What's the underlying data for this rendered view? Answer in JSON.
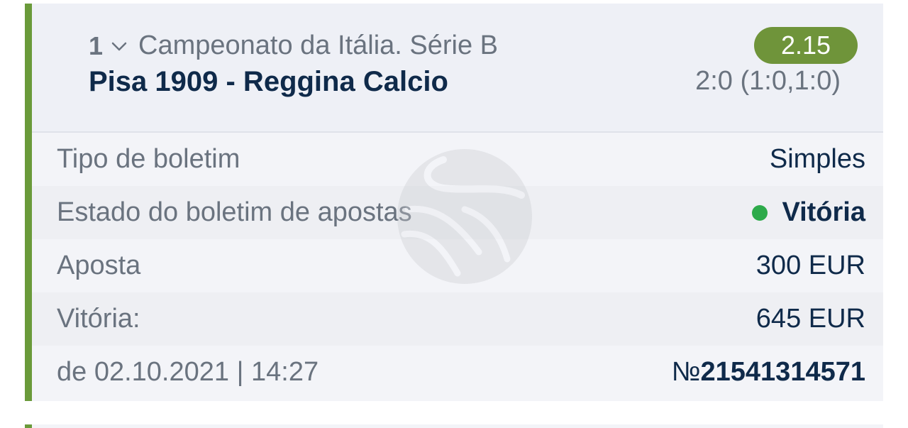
{
  "event": {
    "number": "1",
    "league": "Campeonato da Itália. Série B",
    "teams": "Pisa 1909 - Reggina Calcio",
    "odds": "2.15",
    "score": "2:0 (1:0,1:0)"
  },
  "details": {
    "rows": [
      {
        "label": "Tipo de boletim",
        "value": "Simples"
      },
      {
        "label": "Estado do boletim de apostas",
        "value": "Vitória"
      },
      {
        "label": "Aposta",
        "value": "300 EUR"
      },
      {
        "label": "Vitória:",
        "value": "645 EUR"
      }
    ],
    "date_label": "de 02.10.2021 | 14:27",
    "ticket_prefix": "№",
    "ticket_number": "21541314571"
  },
  "colors": {
    "accent": "#6a9a3a",
    "odds_badge": "#6f943a",
    "status_win": "#2daa4a",
    "text_primary": "#0f2a4a",
    "text_secondary": "#6a737f"
  },
  "icons": {
    "chevron": "chevron-down-icon",
    "watermark": "handshake-logo-icon",
    "status": "status-dot-icon"
  }
}
